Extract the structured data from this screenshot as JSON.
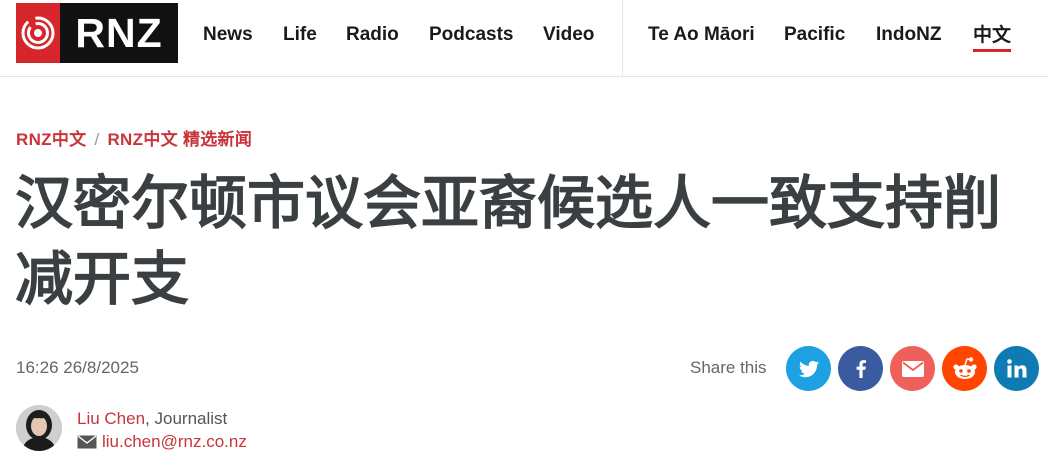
{
  "header": {
    "logo_text": "RNZ",
    "nav_left": [
      "News",
      "Life",
      "Radio",
      "Podcasts",
      "Video"
    ],
    "nav_right": [
      "Te Ao Māori",
      "Pacific",
      "IndoNZ",
      "中文"
    ],
    "active_item": "中文"
  },
  "article": {
    "breadcrumb": [
      "RNZ中文",
      "RNZ中文 精选新闻"
    ],
    "breadcrumb_separator": "/",
    "headline": "汉密尔顿市议会亚裔候选人一致支持削减开支",
    "timestamp": "16:26 26/8/2025",
    "share_label": "Share this",
    "author": {
      "name": "Liu Chen",
      "role": ", Journalist",
      "email": "liu.chen@rnz.co.nz"
    }
  },
  "share_buttons": [
    {
      "icon": "twitter-icon",
      "color": "#1da1e2"
    },
    {
      "icon": "facebook-icon",
      "color": "#3b5ba0"
    },
    {
      "icon": "email-icon",
      "color": "#f0605b"
    },
    {
      "icon": "reddit-icon",
      "color": "#ff4500"
    },
    {
      "icon": "linkedin-icon",
      "color": "#0f7bb5"
    }
  ],
  "colors": {
    "brand_red": "#d5262b",
    "link_red": "#c8353a",
    "headline": "#3a3f42"
  }
}
